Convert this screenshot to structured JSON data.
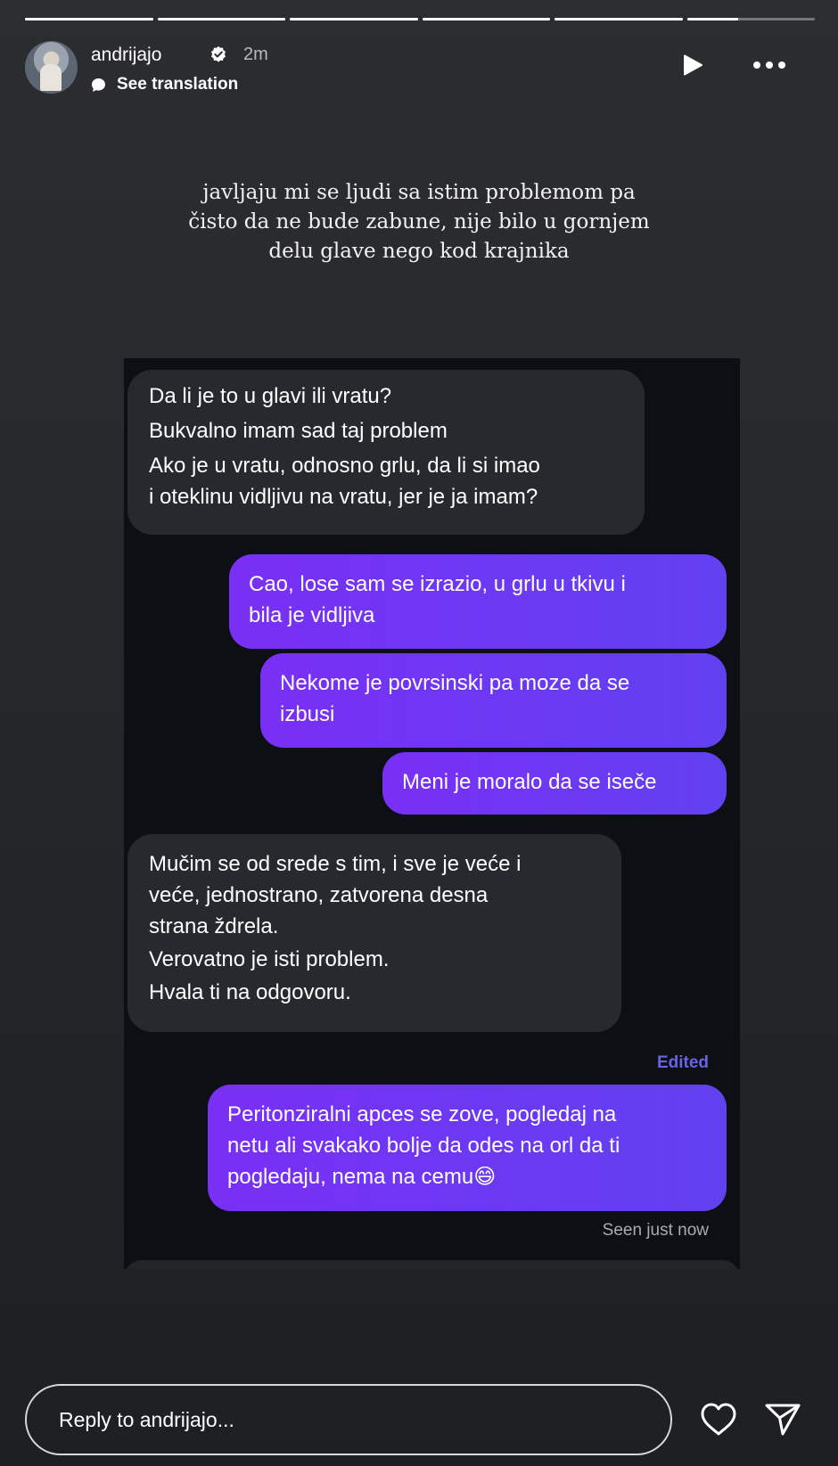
{
  "story": {
    "segments": [
      {
        "progress": 1.0
      },
      {
        "progress": 1.0
      },
      {
        "progress": 1.0
      },
      {
        "progress": 1.0
      },
      {
        "progress": 1.0
      },
      {
        "progress": 0.4
      }
    ],
    "username": "andrijajo",
    "time_ago": "2m",
    "see_translation": "See translation",
    "caption_lines": [
      "javljaju mi se ljudi sa istim problemom pa",
      "čisto da ne bude zabune, nije bilo u gornjem",
      "delu glave nego kod krajnika"
    ]
  },
  "chat": {
    "messages": [
      {
        "dir": "in",
        "lines": [
          "Da li je to u glavi ili vratu?",
          "Bukvalno imam sad taj problem",
          "Ako je u vratu, odnosno grlu, da li si imao",
          "i oteklinu vidljivu na vratu, jer je ja imam?"
        ]
      },
      {
        "dir": "out",
        "lines": [
          "Cao, lose sam se izrazio, u grlu u tkivu i",
          "bila je vidljiva"
        ]
      },
      {
        "dir": "out",
        "lines": [
          "Nekome je povrsinski pa moze da se",
          "izbusi"
        ]
      },
      {
        "dir": "out",
        "lines": [
          "Meni je moralo da se iseče"
        ]
      },
      {
        "dir": "in",
        "lines": [
          "Mučim se od srede s tim, i sve je veće i",
          "veće, jednostrano, zatvorena desna",
          "strana ždrela.",
          "Verovatno je isti problem.",
          "Hvala ti na odgovoru."
        ]
      },
      {
        "dir": "out",
        "lines": [
          "Peritonziralni apces se zove, pogledaj na",
          "netu ali svakako bolje da odes na orl da ti",
          "pogledaju, nema na cemu😄"
        ]
      }
    ],
    "edited_label": "Edited",
    "seen_label": "Seen just now"
  },
  "footer": {
    "reply_placeholder": "Reply to andrijajo...",
    "heart_icon": "heart-icon",
    "send_icon": "send-icon"
  },
  "colors": {
    "background": "#2b2d31",
    "incoming_bubble": "#262a2f",
    "outgoing_bubble_start": "#7a2ff5",
    "outgoing_bubble_end": "#6241f0",
    "edited": "#6b63e6"
  }
}
